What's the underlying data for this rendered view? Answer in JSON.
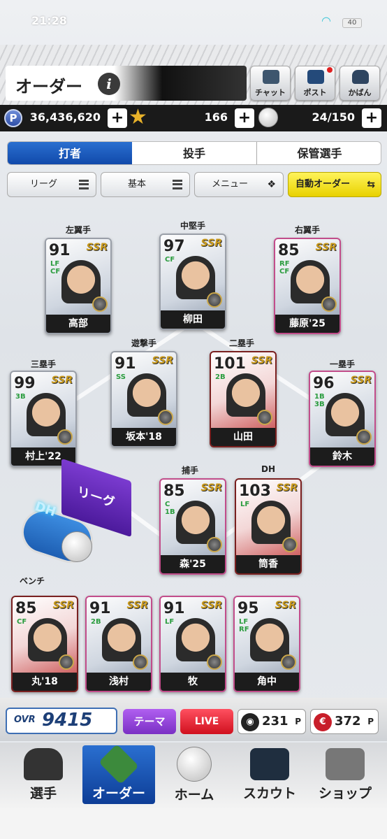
{
  "status": {
    "time": "21:28",
    "battery": "40"
  },
  "header": {
    "title": "オーダー",
    "info": "i",
    "buttons": [
      "チャット",
      "ポスト",
      "かばん"
    ]
  },
  "currency": {
    "p": "P",
    "points": "36,436,620",
    "stars": "166",
    "balls": "24/150",
    "plus": "+"
  },
  "tabs": [
    "打者",
    "投手",
    "保管選手"
  ],
  "filters": [
    "リーグ",
    "基本",
    "メニュー",
    "自動オーダー"
  ],
  "positions": {
    "lf": "左翼手",
    "cf": "中堅手",
    "rf": "右翼手",
    "ss": "遊撃手",
    "2b": "二塁手",
    "3b": "三塁手",
    "1b": "一塁手",
    "c": "捕手",
    "dh": "DH"
  },
  "cards": {
    "lf": {
      "ovr": "91",
      "pos": "LF\nCF",
      "name": "高部"
    },
    "cf": {
      "ovr": "97",
      "pos": "CF",
      "name": "柳田"
    },
    "rf": {
      "ovr": "85",
      "pos": "RF\nCF",
      "name": "藤原'25"
    },
    "ss": {
      "ovr": "91",
      "pos": "SS",
      "name": "坂本'18"
    },
    "2b": {
      "ovr": "101",
      "pos": "2B",
      "name": "山田"
    },
    "3b": {
      "ovr": "99",
      "pos": "3B",
      "name": "村上'22"
    },
    "1b": {
      "ovr": "96",
      "pos": "1B\n3B",
      "name": "鈴木"
    },
    "c": {
      "ovr": "85",
      "pos": "C\n1B",
      "name": "森'25"
    },
    "dh": {
      "ovr": "103",
      "pos": "LF",
      "name": "筒香"
    },
    "ssr": "SSR"
  },
  "bench": {
    "label": "ベンチ",
    "cards": [
      {
        "ovr": "85",
        "pos": "CF",
        "name": "丸'18"
      },
      {
        "ovr": "91",
        "pos": "2B",
        "name": "浅村"
      },
      {
        "ovr": "91",
        "pos": "LF",
        "name": "牧"
      },
      {
        "ovr": "95",
        "pos": "LF\nRF",
        "name": "角中"
      }
    ]
  },
  "dh_toggle": {
    "sign": "リーグ",
    "label": "DH"
  },
  "stats": {
    "ovr_label": "OVR",
    "ovr": "9415",
    "theme": "テーマ",
    "live": "LIVE",
    "p1": "231",
    "p2": "372",
    "p_unit": "P"
  },
  "nav": [
    "選手",
    "オーダー",
    "ホーム",
    "スカウト",
    "ショップ"
  ]
}
